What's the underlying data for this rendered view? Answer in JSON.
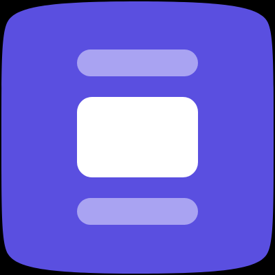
{
  "icon": {
    "name": "carousel-layout-app-icon",
    "colors": {
      "background": "#000000",
      "tile": "#5A4FE0",
      "bar": "#A9A3F2",
      "card": "#FFFFFF"
    }
  }
}
